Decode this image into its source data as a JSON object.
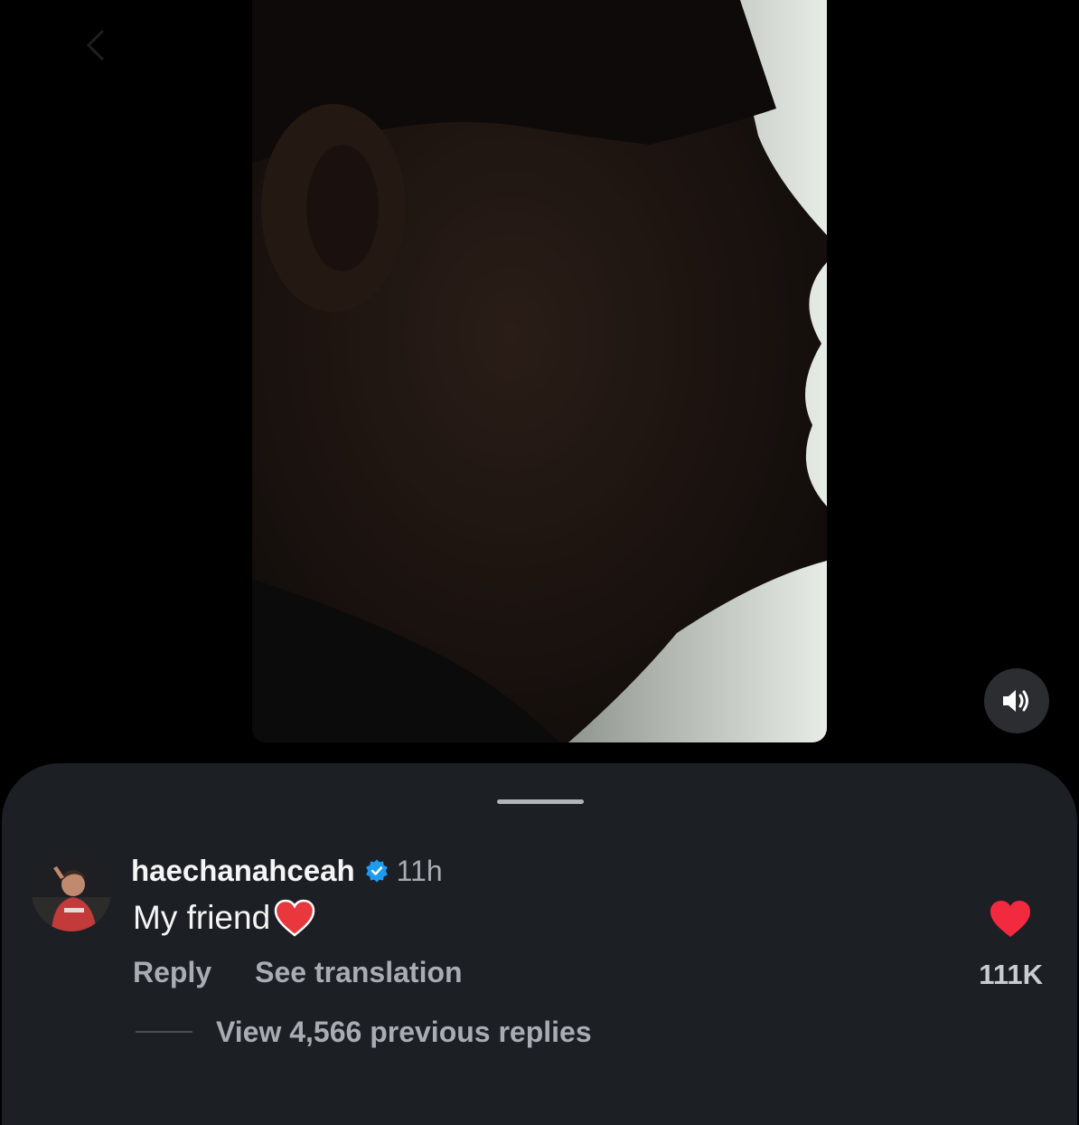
{
  "post": {
    "media_type": "video",
    "sound_icon": "speaker-on-icon"
  },
  "comments_sheet": {
    "comment": {
      "username": "haechanahceah",
      "verified": true,
      "timestamp": "11h",
      "text": "My friend",
      "emoji": "❤️",
      "reply_label": "Reply",
      "translate_label": "See translation",
      "likes": "111K",
      "liked": true,
      "view_replies_label": "View 4,566 previous replies"
    }
  },
  "colors": {
    "background": "#000000",
    "sheet": "#1c1f24",
    "like_red": "#f22a3f",
    "verified_blue": "#1d9bf0",
    "secondary_text": "#a8acb3"
  }
}
